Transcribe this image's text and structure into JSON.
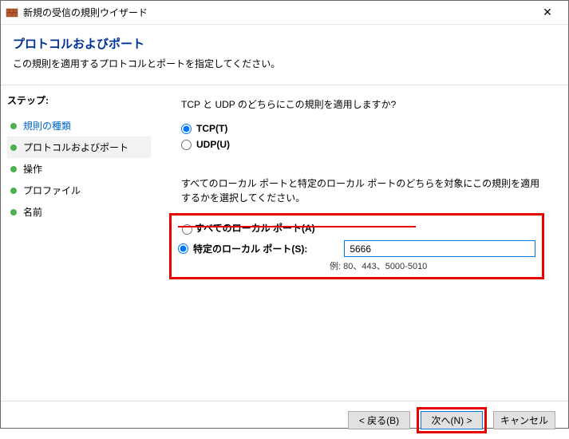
{
  "titlebar": {
    "title": "新規の受信の規則ウイザード",
    "close": "✕"
  },
  "header": {
    "title": "プロトコルおよびポート",
    "subtitle": "この規則を適用するプロトコルとポートを指定してください。"
  },
  "sidebar": {
    "heading": "ステップ:",
    "items": [
      {
        "label": "規則の種類",
        "link": true
      },
      {
        "label": "プロトコルおよびポート",
        "selected": true
      },
      {
        "label": "操作"
      },
      {
        "label": "プロファイル"
      },
      {
        "label": "名前"
      }
    ]
  },
  "content": {
    "q1": "TCP と UDP のどちらにこの規則を適用しますか?",
    "tcp_label": "TCP(T)",
    "udp_label": "UDP(U)",
    "q2": "すべてのローカル ポートと特定のローカル ポートのどちらを対象にこの規則を適用するかを選択してください。",
    "all_ports_label": "すべてのローカル ポート(A)",
    "specific_ports_label": "特定のローカル ポート(S):",
    "port_value": "5666",
    "example": "例: 80、443、5000-5010"
  },
  "footer": {
    "back": "< 戻る(B)",
    "next": "次へ(N) >",
    "cancel": "キャンセル"
  }
}
